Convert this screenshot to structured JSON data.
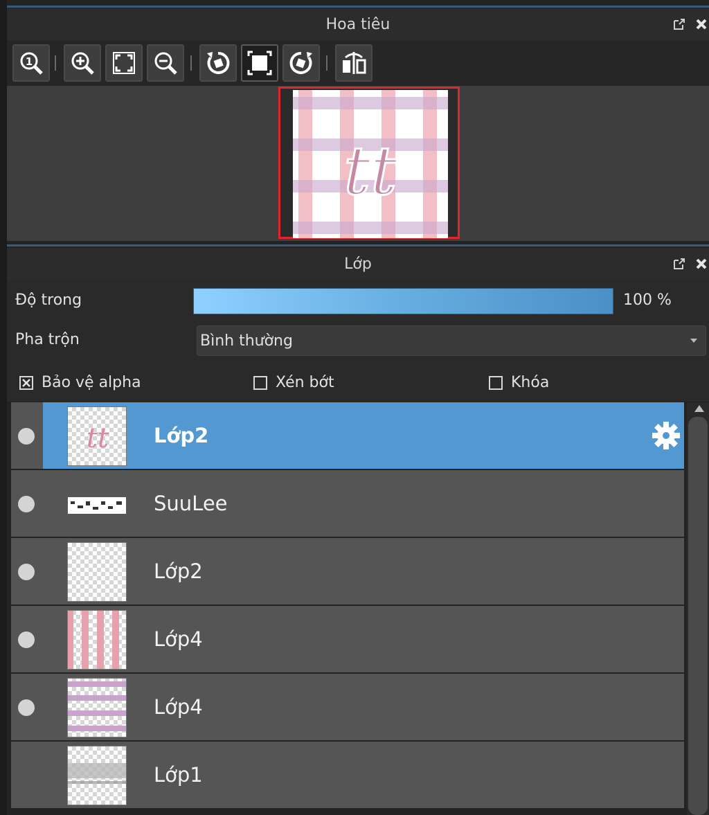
{
  "navigator": {
    "title": "Hoa tiêu",
    "toolbar": [
      "zoom-actual-size-icon",
      "zoom-in-icon",
      "fit-to-window-icon",
      "zoom-out-icon",
      "rotate-left-icon",
      "fit-canvas-icon",
      "rotate-right-icon",
      "flip-horizontal-icon"
    ]
  },
  "layers_panel": {
    "title": "Lớp",
    "opacity_label": "Độ trong",
    "opacity_value": "100 %",
    "opacity_fraction": 1.0,
    "blend_label": "Pha trộn",
    "blend_value": "Bình thường",
    "protect_alpha_label": "Bảo vệ alpha",
    "protect_alpha_checked": true,
    "clipping_label": "Xén bớt",
    "clipping_checked": false,
    "lock_label": "Khóa",
    "lock_checked": false
  },
  "layers": [
    {
      "name": "Lớp2",
      "selected": true,
      "visible": true,
      "thumb": "tt-letters"
    },
    {
      "name": "SuuLee",
      "selected": false,
      "visible": true,
      "thumb": "text-strip"
    },
    {
      "name": "Lớp2",
      "selected": false,
      "visible": true,
      "thumb": "transparent"
    },
    {
      "name": "Lớp4",
      "selected": false,
      "visible": true,
      "thumb": "pink-vertical-stripes"
    },
    {
      "name": "Lớp4",
      "selected": false,
      "visible": true,
      "thumb": "purple-horizontal-stripes"
    },
    {
      "name": "Lớp1",
      "selected": false,
      "visible": false,
      "thumb": "gray-band"
    }
  ],
  "colors": {
    "selected_row": "#5398d0",
    "row": "#555555",
    "accent_border": "#e0262c"
  }
}
